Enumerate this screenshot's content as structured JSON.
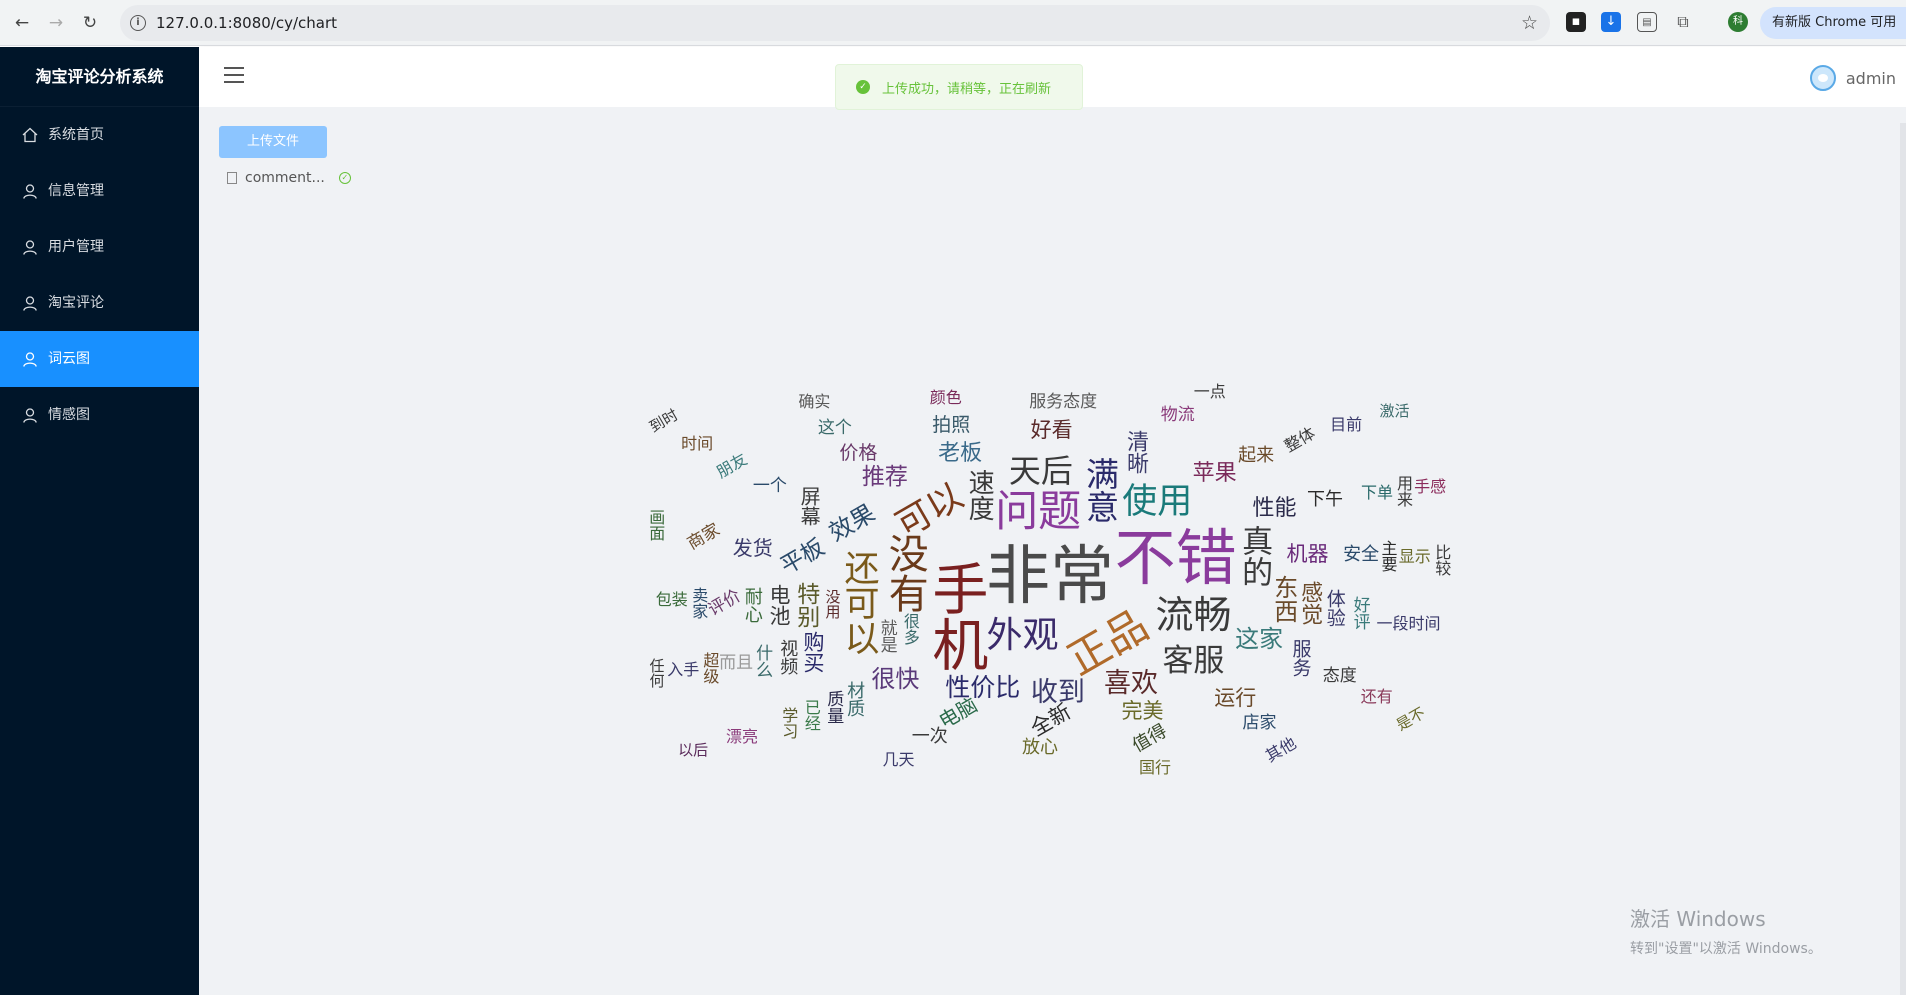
{
  "browser": {
    "url": "127.0.0.1:8080/cy/chart",
    "update_label": "有新版 Chrome 可用",
    "profile_initial": "科"
  },
  "sidebar": {
    "title": "淘宝评论分析系统",
    "items": [
      {
        "label": "系统首页",
        "icon": "home-icon"
      },
      {
        "label": "信息管理",
        "icon": "user-icon"
      },
      {
        "label": "用户管理",
        "icon": "user-icon"
      },
      {
        "label": "淘宝评论",
        "icon": "user-icon"
      },
      {
        "label": "词云图",
        "icon": "user-icon",
        "active": true
      },
      {
        "label": "情感图",
        "icon": "user-icon"
      }
    ]
  },
  "header": {
    "username": "admin"
  },
  "toast": {
    "message": "上传成功，请稍等，正在刷新"
  },
  "main": {
    "upload_label": "上传文件",
    "file_name": "comment..."
  },
  "wordcloud": {
    "words": [
      {
        "text": "非常",
        "weight": 1.0,
        "color": "#4a4a4a"
      },
      {
        "text": "不错",
        "weight": 0.95,
        "color": "#8a3b9c"
      },
      {
        "text": "手机",
        "weight": 0.85,
        "color": "#7a2020"
      },
      {
        "text": "问题",
        "weight": 0.6,
        "color": "#8a3b9c"
      },
      {
        "text": "没有",
        "weight": 0.55,
        "color": "#6a3a1a"
      },
      {
        "text": "正品",
        "weight": 0.58,
        "color": "#b06a2a"
      },
      {
        "text": "流畅",
        "weight": 0.5,
        "color": "#3a3a3a"
      },
      {
        "text": "外观",
        "weight": 0.48,
        "color": "#3a2a6a"
      },
      {
        "text": "还可以",
        "weight": 0.45,
        "color": "#7a5a1a"
      },
      {
        "text": "满意",
        "weight": 0.42,
        "color": "#2a2a6a"
      },
      {
        "text": "可以",
        "weight": 0.45,
        "color": "#7a3a1a"
      },
      {
        "text": "使用",
        "weight": 0.45,
        "color": "#1a7a7a"
      },
      {
        "text": "客服",
        "weight": 0.38,
        "color": "#3a3a3a"
      },
      {
        "text": "真的",
        "weight": 0.38,
        "color": "#3a3a3a"
      },
      {
        "text": "喜欢",
        "weight": 0.3,
        "color": "#5a2a2a"
      },
      {
        "text": "收到",
        "weight": 0.3,
        "color": "#3a3a6a"
      },
      {
        "text": "速度",
        "weight": 0.28,
        "color": "#3a3a3a"
      },
      {
        "text": "天后",
        "weight": 0.4,
        "color": "#3a3a3a"
      },
      {
        "text": "性价比",
        "weight": 0.26,
        "color": "#2a2a6a"
      },
      {
        "text": "效果",
        "weight": 0.25,
        "color": "#2a4a6a"
      },
      {
        "text": "东西",
        "weight": 0.24,
        "color": "#6a4a2a"
      },
      {
        "text": "这家",
        "weight": 0.24,
        "color": "#3a7a7a"
      },
      {
        "text": "很快",
        "weight": 0.24,
        "color": "#5a3a7a"
      },
      {
        "text": "特别",
        "weight": 0.22,
        "color": "#5a5a2a"
      },
      {
        "text": "平板",
        "weight": 0.22,
        "color": "#2a4a6a"
      },
      {
        "text": "推荐",
        "weight": 0.22,
        "color": "#6a3a7a"
      },
      {
        "text": "清晰",
        "weight": 0.2,
        "color": "#3a3a6a"
      },
      {
        "text": "老板",
        "weight": 0.2,
        "color": "#3a6a8a"
      },
      {
        "text": "苹果",
        "weight": 0.2,
        "color": "#7a2a5a"
      },
      {
        "text": "感觉",
        "weight": 0.2,
        "color": "#6a4a2a"
      },
      {
        "text": "性能",
        "weight": 0.2,
        "color": "#2a2a4a"
      },
      {
        "text": "机器",
        "weight": 0.19,
        "color": "#6a2a7a"
      },
      {
        "text": "完美",
        "weight": 0.18,
        "color": "#6a6a2a"
      },
      {
        "text": "全新",
        "weight": 0.18,
        "color": "#2a2a2a"
      },
      {
        "text": "购买",
        "weight": 0.19,
        "color": "#2a2a6a"
      },
      {
        "text": "电池",
        "weight": 0.18,
        "color": "#3a3a3a"
      },
      {
        "text": "好看",
        "weight": 0.18,
        "color": "#5a2a2a"
      },
      {
        "text": "运行",
        "weight": 0.18,
        "color": "#6a4a2a"
      },
      {
        "text": "屏幕",
        "weight": 0.17,
        "color": "#3a3a3a"
      },
      {
        "text": "电脑",
        "weight": 0.17,
        "color": "#2a6a4a"
      },
      {
        "text": "体验",
        "weight": 0.16,
        "color": "#3a3a6a"
      },
      {
        "text": "价格",
        "weight": 0.16,
        "color": "#6a3a6a"
      },
      {
        "text": "拍照",
        "weight": 0.16,
        "color": "#3a5a6a"
      },
      {
        "text": "发货",
        "weight": 0.17,
        "color": "#3a3a6a"
      },
      {
        "text": "服务",
        "weight": 0.16,
        "color": "#3a3a6a"
      },
      {
        "text": "起来",
        "weight": 0.14,
        "color": "#6a4a2a"
      },
      {
        "text": "下午",
        "weight": 0.14,
        "color": "#2a2a2a"
      },
      {
        "text": "材质",
        "weight": 0.14,
        "color": "#3a6a6a"
      },
      {
        "text": "安全",
        "weight": 0.14,
        "color": "#2a4a6a"
      },
      {
        "text": "值得",
        "weight": 0.14,
        "color": "#3a4a2a"
      },
      {
        "text": "视频",
        "weight": 0.14,
        "color": "#3a3a3a"
      },
      {
        "text": "放心",
        "weight": 0.14,
        "color": "#6a6a2a"
      },
      {
        "text": "一次",
        "weight": 0.14,
        "color": "#3a3a3a"
      },
      {
        "text": "耐心",
        "weight": 0.13,
        "color": "#3a6a3a"
      },
      {
        "text": "评价",
        "weight": 0.12,
        "color": "#6a3a6a"
      },
      {
        "text": "一个",
        "weight": 0.12,
        "color": "#2a4a6a"
      },
      {
        "text": "态度",
        "weight": 0.11,
        "color": "#3a3a3a"
      },
      {
        "text": "店家",
        "weight": 0.11,
        "color": "#2a4a6a"
      },
      {
        "text": "质量",
        "weight": 0.11,
        "color": "#2a2a4a"
      },
      {
        "text": "而且",
        "weight": 0.11,
        "color": "#999999"
      },
      {
        "text": "商家",
        "weight": 0.11,
        "color": "#6a4a2a"
      },
      {
        "text": "颜色",
        "weight": 0.1,
        "color": "#7a2a5a"
      },
      {
        "text": "很多",
        "weight": 0.1,
        "color": "#3a6a6a"
      },
      {
        "text": "就是",
        "weight": 0.12,
        "color": "#5a5a5a"
      },
      {
        "text": "服务态度",
        "weight": 0.12,
        "color": "#5a5a5a"
      },
      {
        "text": "物流",
        "weight": 0.12,
        "color": "#8a3a7a"
      },
      {
        "text": "好评",
        "weight": 0.12,
        "color": "#3a7a7a"
      },
      {
        "text": "整体",
        "weight": 0.1,
        "color": "#3a3a3a"
      },
      {
        "text": "下单",
        "weight": 0.1,
        "color": "#2a6a6a"
      },
      {
        "text": "主要",
        "weight": 0.1,
        "color": "#2a2a2a"
      },
      {
        "text": "显示",
        "weight": 0.1,
        "color": "#6a6a2a"
      },
      {
        "text": "一段时间",
        "weight": 0.1,
        "color": "#3a3a6a"
      },
      {
        "text": "已经",
        "weight": 0.1,
        "color": "#3a7a4a"
      },
      {
        "text": "其他",
        "weight": 0.09,
        "color": "#3a3a6a"
      },
      {
        "text": "什么",
        "weight": 0.11,
        "color": "#3a6a6a"
      },
      {
        "text": "入手",
        "weight": 0.09,
        "color": "#3a3a6a"
      },
      {
        "text": "用来",
        "weight": 0.09,
        "color": "#3a3a3a"
      },
      {
        "text": "确实",
        "weight": 0.09,
        "color": "#5a5a5a"
      },
      {
        "text": "国行",
        "weight": 0.1,
        "color": "#6a6a2a"
      },
      {
        "text": "目前",
        "weight": 0.09,
        "color": "#3a3a6a"
      },
      {
        "text": "是不",
        "weight": 0.08,
        "color": "#6a6a2a"
      },
      {
        "text": "几天",
        "weight": 0.1,
        "color": "#3a3a6a"
      },
      {
        "text": "卖家",
        "weight": 0.1,
        "color": "#2a4a6a"
      },
      {
        "text": "包装",
        "weight": 0.1,
        "color": "#3a6a3a"
      },
      {
        "text": "朋友",
        "weight": 0.1,
        "color": "#3a7a7a"
      },
      {
        "text": "这个",
        "weight": 0.11,
        "color": "#3a6a6a"
      },
      {
        "text": "学习",
        "weight": 0.1,
        "color": "#5a5a2a"
      },
      {
        "text": "一点",
        "weight": 0.1,
        "color": "#3a3a3a"
      },
      {
        "text": "比较",
        "weight": 0.09,
        "color": "#3a3a3a"
      },
      {
        "text": "还有",
        "weight": 0.1,
        "color": "#8a3a5a"
      },
      {
        "text": "超级",
        "weight": 0.1,
        "color": "#6a4a2a"
      },
      {
        "text": "手感",
        "weight": 0.09,
        "color": "#8a2a5a"
      },
      {
        "text": "漂亮",
        "weight": 0.09,
        "color": "#8a3a7a"
      },
      {
        "text": "画面",
        "weight": 0.09,
        "color": "#3a6a3a"
      },
      {
        "text": "时间",
        "weight": 0.09,
        "color": "#6a4a2a"
      },
      {
        "text": "没用",
        "weight": 0.08,
        "color": "#5a2a2a"
      },
      {
        "text": "激活",
        "weight": 0.08,
        "color": "#3a6a6a"
      },
      {
        "text": "以后",
        "weight": 0.08,
        "color": "#5a2a5a"
      },
      {
        "text": "任何",
        "weight": 0.08,
        "color": "#3a3a3a"
      },
      {
        "text": "到时",
        "weight": 0.08,
        "color": "#3a3a3a"
      }
    ]
  },
  "watermark": {
    "line1": "激活 Windows",
    "line2": "转到\"设置\"以激活 Windows。"
  }
}
